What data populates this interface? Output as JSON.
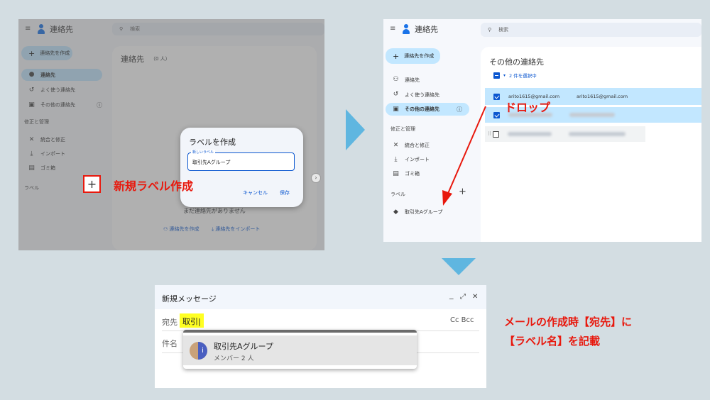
{
  "panel1": {
    "app_title": "連絡先",
    "search_placeholder": "検索",
    "create_contact": "連絡先を作成",
    "nav": [
      "連絡先",
      "よく使う連絡先",
      "その他の連絡先"
    ],
    "section_fix": "修正と管理",
    "fix_items": [
      "統合と修正",
      "インポート",
      "ゴミ箱"
    ],
    "section_labels": "ラベル",
    "main_title": "連絡先",
    "main_count": "（0 人）",
    "empty_text": "まだ連絡先がありません",
    "create_link": "連絡先を作成",
    "import_link": "連絡先をインポート",
    "dialog": {
      "title": "ラベルを作成",
      "field_label": "新しいラベル",
      "field_value": "取引先Aグループ",
      "cancel": "キャンセル",
      "save": "保存"
    },
    "annotation": "新規ラベル作成"
  },
  "panel2": {
    "app_title": "連絡先",
    "search_placeholder": "検索",
    "create_contact": "連絡先を作成",
    "nav": [
      "連絡先",
      "よく使う連絡先",
      "その他の連絡先"
    ],
    "section_fix": "修正と管理",
    "fix_items": [
      "統合と修正",
      "インポート",
      "ゴミ箱"
    ],
    "section_labels": "ラベル",
    "label_item": "取引先Aグループ",
    "main_title": "その他の連絡先",
    "selected_count": "2 件を選択中",
    "row1_email_a": "arito1615@gmail.com",
    "row1_email_b": "arito1615@gmail.com",
    "annotation": "ドロップ"
  },
  "panel3": {
    "title": "新規メッセージ",
    "to_label": "宛先",
    "to_value": "取引",
    "cc_bcc": "Cc Bcc",
    "subject_label": "件名",
    "suggest_name": "取引先Aグループ",
    "suggest_sub": "メンバー 2 人",
    "window_controls": [
      "_",
      "⤢",
      "✕"
    ]
  },
  "annotation3_line1": "メールの作成時【宛先】に",
  "annotation3_line2": "【ラベル名】を記載",
  "colors": {
    "accent_red": "#e8180d",
    "selection_blue": "#c2e7ff",
    "arrow_blue": "#5fb6e0"
  }
}
